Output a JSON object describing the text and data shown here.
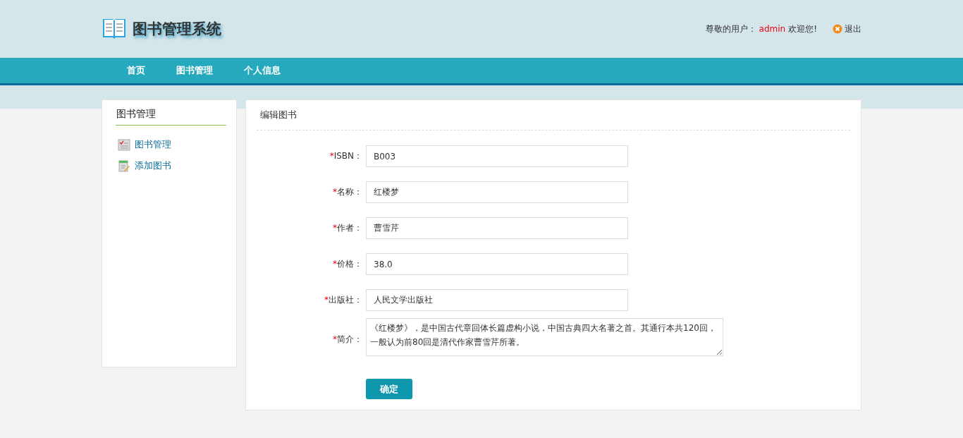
{
  "header": {
    "title": "图书管理系统",
    "greeting": "尊敬的用户：",
    "username": "admin",
    "welcome": "欢迎您!",
    "logout": "退出"
  },
  "nav": [
    {
      "label": "首页"
    },
    {
      "label": "图书管理"
    },
    {
      "label": "个人信息"
    }
  ],
  "sidebar": {
    "title": "图书管理",
    "items": [
      {
        "label": "图书管理",
        "kind": "list"
      },
      {
        "label": "添加图书",
        "kind": "add"
      }
    ]
  },
  "form": {
    "title": "编辑图书",
    "fields": [
      {
        "mark": "*",
        "label": "ISBN：",
        "value": "B003",
        "kind": "input"
      },
      {
        "mark": "*",
        "label": "名称：",
        "value": "红楼梦",
        "kind": "input"
      },
      {
        "mark": "*",
        "label": "作者：",
        "value": "曹雪芹",
        "kind": "input"
      },
      {
        "mark": "*",
        "label": "价格：",
        "value": "38.0",
        "kind": "input"
      },
      {
        "mark": "*",
        "label": "出版社：",
        "value": "人民文学出版社",
        "kind": "input"
      },
      {
        "mark": "*",
        "label": "简介：",
        "value": "《红楼梦》，是中国古代章回体长篇虚构小说，中国古典四大名著之首。其通行本共120回，一般认为前80回是清代作家曹雪芹所著。",
        "kind": "textarea"
      }
    ],
    "submit": "确定"
  }
}
